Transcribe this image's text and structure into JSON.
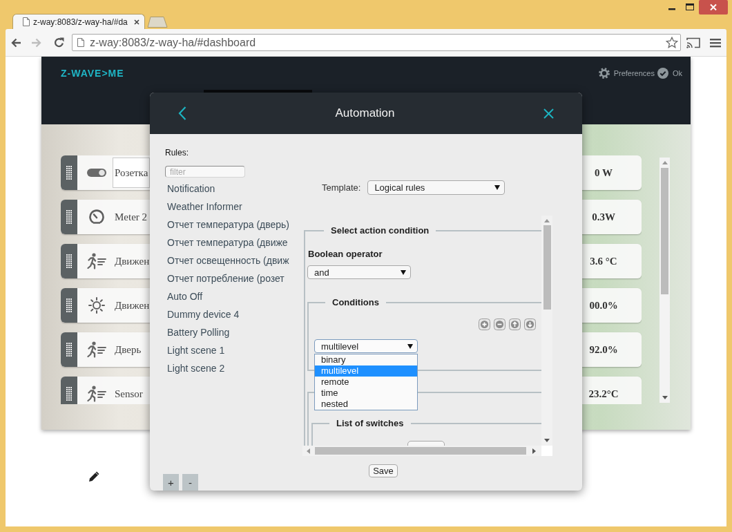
{
  "browser": {
    "tabs": [
      {
        "title": "z-way:8083/z-way-ha/#da",
        "selected": true
      }
    ],
    "url": "z-way:8083/z-way-ha/#dashboard"
  },
  "dashboard": {
    "logo": "Z-WAVE>ME",
    "actions": [
      {
        "kind": "preferences",
        "label": "Preferences"
      },
      {
        "kind": "ok",
        "label": "Ok"
      }
    ],
    "devices": [
      {
        "kind": "switch",
        "name": "Розетка",
        "value": "0 W",
        "focused": true
      },
      {
        "kind": "meter",
        "name": "Meter 2",
        "value": "0.3W",
        "focused": false
      },
      {
        "kind": "motion",
        "name": "Движен",
        "value": "3.6 °C",
        "focused": false
      },
      {
        "kind": "light",
        "name": "Движен",
        "value": "00.0%",
        "focused": false
      },
      {
        "kind": "motion",
        "name": "Дверь",
        "value": "92.0%",
        "focused": false
      },
      {
        "kind": "motion",
        "name": "Sensor",
        "value": "23.2°C",
        "focused": false
      }
    ]
  },
  "automation": {
    "title": "Automation",
    "rules_label": "Rules:",
    "filter": {
      "placeholder": "filter"
    },
    "rules": [
      {
        "name": "Notification",
        "selected": false
      },
      {
        "name": "Weather Informer",
        "selected": false
      },
      {
        "name": "Отчет температура (дверь)",
        "selected": false
      },
      {
        "name": "Отчет температура (движе",
        "selected": false
      },
      {
        "name": "Отчет освещенность (движ",
        "selected": false
      },
      {
        "name": "Отчет потребление (розет",
        "selected": false
      },
      {
        "name": "Auto Off",
        "selected": false
      },
      {
        "name": "Dummy device 4",
        "selected": false
      },
      {
        "name": "Battery Polling",
        "selected": false
      },
      {
        "name": "Light scene 1",
        "selected": false
      },
      {
        "name": "Light scene 2",
        "selected": false
      }
    ],
    "rule_buttons": [
      "+",
      "-"
    ],
    "template": {
      "label": "Template:",
      "value": "Logical rules"
    },
    "action_condition": {
      "legend": "Select action condition",
      "operator": {
        "label": "Boolean operator",
        "value": "and"
      },
      "conditions": {
        "legend": "Conditions",
        "type": {
          "value": "multilevel",
          "expanded": true,
          "options": [
            {
              "label": "binary",
              "selected": false
            },
            {
              "label": "multilevel",
              "selected": true
            },
            {
              "label": "remote",
              "selected": false
            },
            {
              "label": "time",
              "selected": false
            },
            {
              "label": "nested",
              "selected": false
            }
          ]
        }
      },
      "switches": {
        "legend": "List of switches"
      }
    },
    "save_button": "Save"
  }
}
